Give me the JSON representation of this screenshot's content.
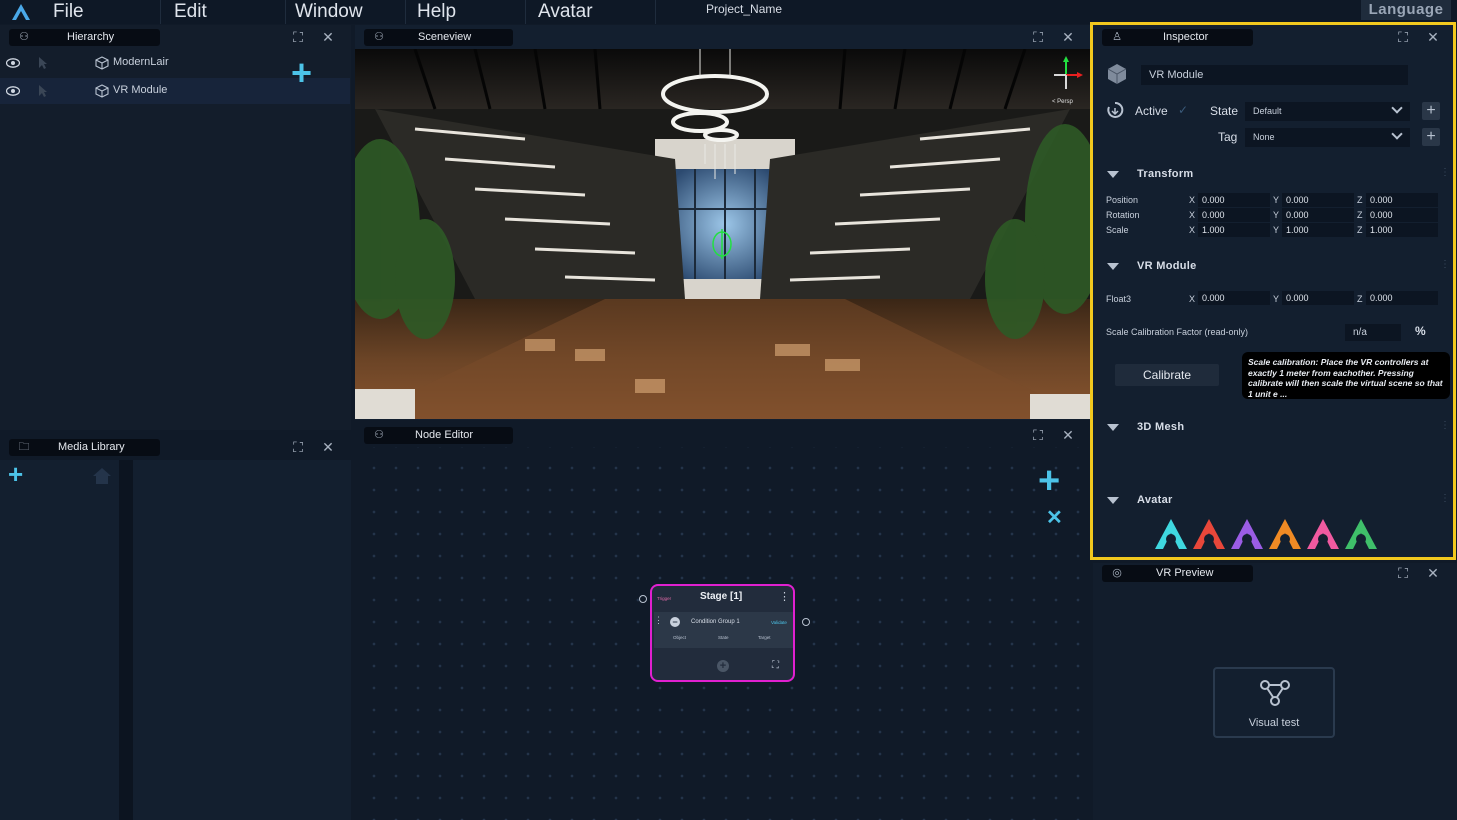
{
  "menu": {
    "file": "File",
    "edit": "Edit",
    "window": "Window",
    "help": "Help",
    "avatar": "Avatar",
    "project_name": "Project_Name",
    "language": "Language"
  },
  "hierarchy": {
    "tab_label": "Hierarchy",
    "items": [
      {
        "label": "ModernLair"
      },
      {
        "label": "VR Module"
      }
    ]
  },
  "sceneview": {
    "tab_label": "Sceneview",
    "persp_label": "< Persp"
  },
  "media_library": {
    "tab_label": "Media Library"
  },
  "node_editor": {
    "tab_label": "Node Editor",
    "node": {
      "title": "Stage [1]",
      "trigger_label": "Trigger",
      "condition_group": "Condition Group 1",
      "validate_label": "Validate",
      "columns": [
        "Object",
        "State",
        "Target"
      ]
    }
  },
  "inspector": {
    "tab_label": "Inspector",
    "object_name": "VR Module",
    "active_label": "Active",
    "active_check": "✓",
    "state_label": "State",
    "state_value": "Default",
    "tag_label": "Tag",
    "tag_value": "None",
    "transform": {
      "title": "Transform",
      "rows": [
        {
          "label": "Position",
          "x": "0.000",
          "y": "0.000",
          "z": "0.000"
        },
        {
          "label": "Rotation",
          "x": "0.000",
          "y": "0.000",
          "z": "0.000"
        },
        {
          "label": "Scale",
          "x": "1.000",
          "y": "1.000",
          "z": "1.000"
        }
      ],
      "axes": [
        "X",
        "Y",
        "Z"
      ]
    },
    "vr_module": {
      "title": "VR Module",
      "float3_label": "Float3",
      "float3": {
        "x": "0.000",
        "y": "0.000",
        "z": "0.000"
      },
      "scale_cal_label": "Scale Calibration Factor (read-only)",
      "scale_cal_value": "n/a",
      "percent": "%",
      "calibrate_label": "Calibrate",
      "tooltip": "Scale calibration: Place the VR controllers at exactly 1 meter from eachother. Pressing calibrate will then scale the virtual scene so that 1 unit e ..."
    },
    "mesh_title": "3D Mesh",
    "avatar_title": "Avatar",
    "avatar_colors": [
      "#3fd8e0",
      "#e8473a",
      "#9b5de5",
      "#f08a24",
      "#f05aa0",
      "#3fbf6a"
    ]
  },
  "vr_preview": {
    "tab_label": "VR Preview",
    "visual_test_label": "Visual test"
  },
  "colors": {
    "accent": "#4cc3e8",
    "highlight_border": "#f2c81e",
    "node_border": "#e020d0"
  }
}
